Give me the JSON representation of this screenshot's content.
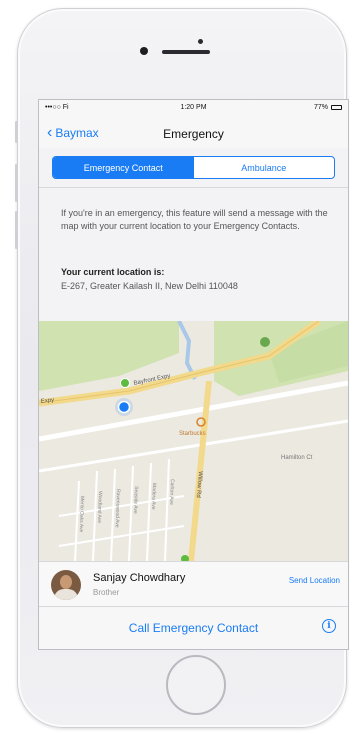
{
  "status_bar": {
    "carrier": "•••○○ Fi",
    "time": "1:20 PM",
    "battery": "77%"
  },
  "nav": {
    "back_label": "Baymax",
    "title": "Emergency"
  },
  "segments": {
    "active": "Emergency Contact",
    "inactive": "Ambulance"
  },
  "info": {
    "message": "If you're in an emergency, this feature will send a message with the map with your current location to your Emergency Contacts.",
    "location_label": "Your current location is:",
    "location_value": "E-267, Greater Kailash II, New Delhi 110048"
  },
  "map": {
    "road_main": "Bayfront Expy",
    "road_left": "Expy",
    "road_vertical": "Willow Rd",
    "poi": "Starbucks",
    "street_right": "Hamilton Ct",
    "streets": [
      "Menlo Oaks Ave",
      "Woodland Ave",
      "Ravenswood Ave",
      "Seaside Ave",
      "Madera Ave",
      "Carlton Ave"
    ]
  },
  "contact": {
    "name": "Sanjay Chowdhary",
    "relation": "Brother",
    "send_label": "Send Location"
  },
  "call": {
    "label": "Call Emergency Contact",
    "info_glyph": "i"
  },
  "colors": {
    "accent": "#1a7cf5",
    "park_green": "#cfe2b0",
    "road_yellow": "#f2d98c"
  },
  "icons": [
    "back-chevron-icon",
    "info-icon",
    "location-dot-icon",
    "pin-icon",
    "starbucks-pin-icon"
  ]
}
